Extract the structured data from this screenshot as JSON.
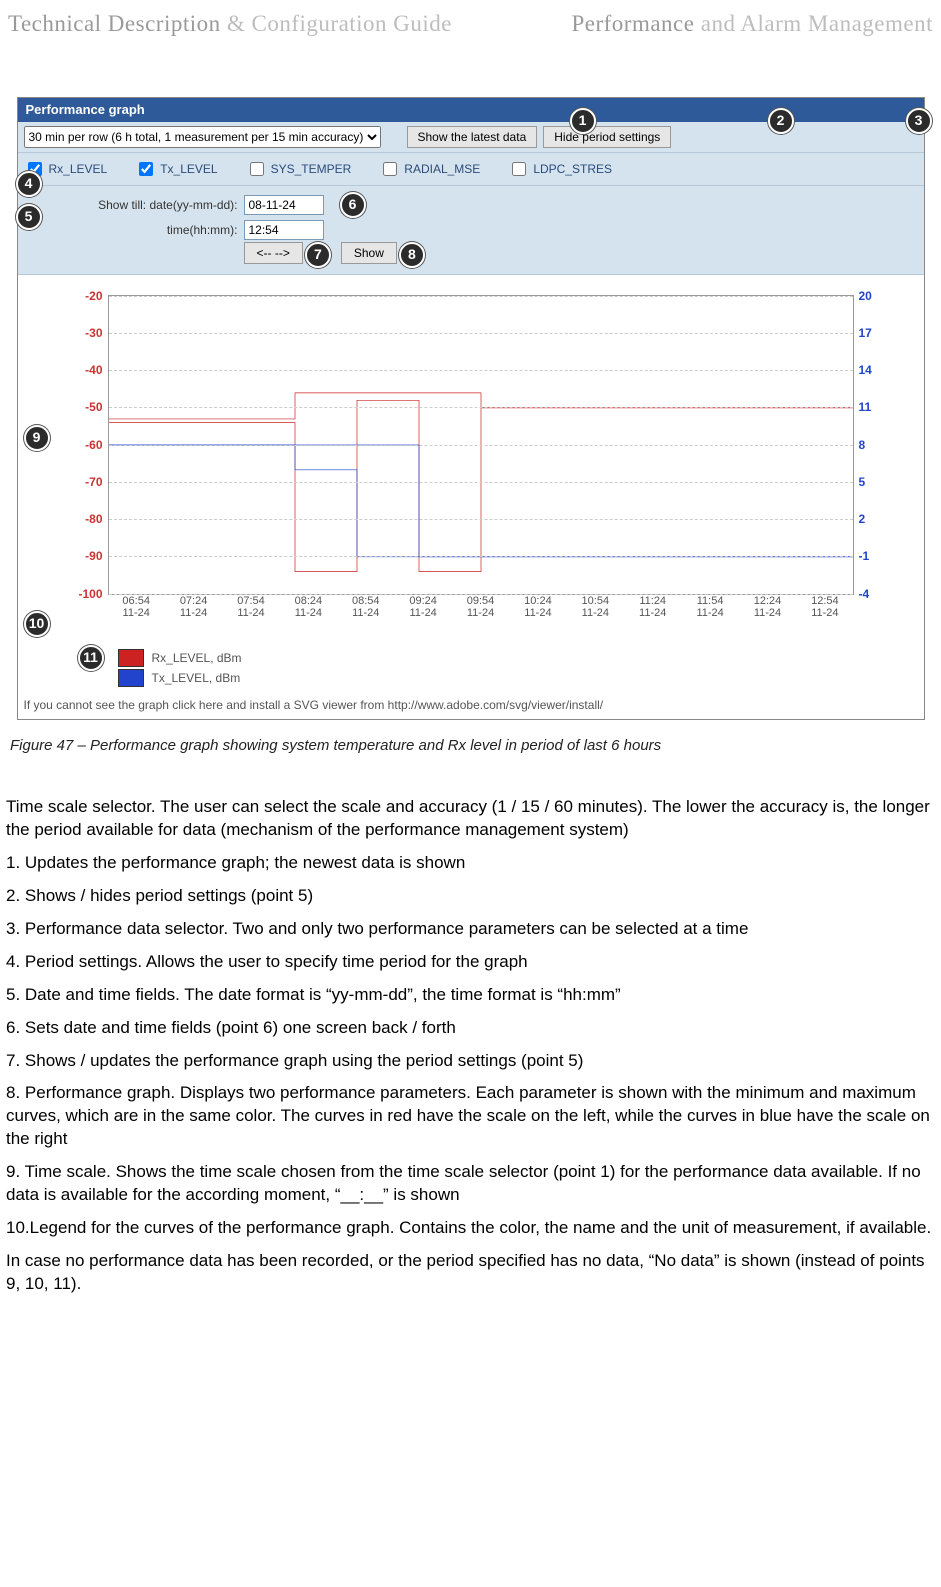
{
  "header": {
    "left_a": "Technical Description",
    "left_b": "& Configuration Guide",
    "right_a": "Performance",
    "right_b": "and Alarm Management"
  },
  "panel": {
    "title": "Performance graph",
    "scale_option": "30 min per row (6 h total, 1 measurement per 15 min accuracy)",
    "show_latest_btn": "Show the latest data",
    "hide_period_btn": "Hide period settings",
    "checks": [
      {
        "label": "Rx_LEVEL",
        "checked": true
      },
      {
        "label": "Tx_LEVEL",
        "checked": true
      },
      {
        "label": "SYS_TEMPER",
        "checked": false
      },
      {
        "label": "RADIAL_MSE",
        "checked": false
      },
      {
        "label": "LDPC_STRES",
        "checked": false
      }
    ],
    "period": {
      "showtill_label": "Show till:",
      "date_label": "date(yy-mm-dd):",
      "time_label": "time(hh:mm):",
      "date_value": "08-11-24",
      "time_value": "12:54",
      "back_fwd_btn": "<--  -->",
      "show_btn": "Show"
    },
    "svg_note": "If you cannot see the graph click here and install a SVG viewer from http://www.adobe.com/svg/viewer/install/"
  },
  "bubbles": {
    "b1": "1",
    "b2": "2",
    "b3": "3",
    "b4": "4",
    "b5": "5",
    "b6": "6",
    "b7": "7",
    "b8": "8",
    "b9": "9",
    "b10": "10",
    "b11": "11"
  },
  "chart_data": {
    "type": "line",
    "title": "",
    "x_categories": [
      "06:54\n11-24",
      "07:24\n11-24",
      "07:54\n11-24",
      "08:24\n11-24",
      "08:54\n11-24",
      "09:24\n11-24",
      "09:54\n11-24",
      "10:24\n11-24",
      "10:54\n11-24",
      "11:24\n11-24",
      "11:54\n11-24",
      "12:24\n11-24",
      "12:54\n11-24"
    ],
    "left_axis": {
      "label": "",
      "color": "#cc2222",
      "ticks": [
        -20,
        -30,
        -40,
        -50,
        -60,
        -70,
        -80,
        -90,
        -100
      ],
      "range": [
        -100,
        -20
      ]
    },
    "right_axis": {
      "label": "",
      "color": "#2244cc",
      "ticks": [
        20,
        17,
        14,
        11,
        8,
        5,
        2,
        -1,
        -4
      ],
      "range": [
        -4,
        20
      ]
    },
    "series": [
      {
        "name": "Rx_LEVEL, dBm",
        "axis": "left",
        "color": "#cc2222",
        "max": [
          -53,
          -53,
          -53,
          -46,
          -46,
          -46,
          -50,
          -50,
          -50,
          -50,
          -50,
          -50,
          -50
        ],
        "min": [
          -54,
          -54,
          -54,
          -94,
          -48,
          -94,
          -50,
          -50,
          -50,
          -50,
          -50,
          -50,
          -50
        ]
      },
      {
        "name": "Tx_LEVEL, dBm",
        "axis": "right",
        "color": "#2244cc",
        "max": [
          8,
          8,
          8,
          8,
          8,
          -1,
          -1,
          -1,
          -1,
          -1,
          -1,
          -1,
          -1
        ],
        "min": [
          8,
          8,
          8,
          6,
          -1,
          -1,
          -1,
          -1,
          -1,
          -1,
          -1,
          -1,
          -1
        ]
      }
    ],
    "legend": [
      {
        "swatch": "#cc2222",
        "text": "Rx_LEVEL, dBm"
      },
      {
        "swatch": "#2244cc",
        "text": "Tx_LEVEL, dBm"
      }
    ]
  },
  "caption": "Figure 47 – Performance graph showing system temperature and Rx level in period of last 6 hours",
  "intro": "Time scale selector. The user can select the scale and accuracy (1 / 15 / 60 minutes). The lower the accuracy is, the longer the period available for data (mechanism of the performance management system)",
  "items": [
    "Updates the performance graph; the newest data is shown",
    "Shows / hides period settings (point 5)",
    "Performance data selector. Two and only two performance parameters can be selected at a time",
    "Period settings. Allows the user to specify time period for the graph",
    "Date and time fields. The date format is “yy-mm-dd”, the time format is “hh:mm”",
    "Sets date and time fields (point 6) one screen back / forth",
    "Shows / updates the performance graph using the period settings (point 5)",
    "Performance graph. Displays two performance parameters. Each parameter is shown with the minimum and maximum curves, which are in the same color. The curves in red have the scale on the left, while the curves in blue have the scale on the right",
    "Time scale. Shows the time scale chosen from the time scale selector (point 1) for the performance data available. If no data is available for the according moment, “__:__” is shown"
  ],
  "item10": "Legend for the curves of the performance graph.  Contains the color, the name and the unit of measurement, if available.",
  "closing": "In case no performance data has been recorded, or the period specified has no data, “No data” is shown (instead of points 9, 10, 11)."
}
